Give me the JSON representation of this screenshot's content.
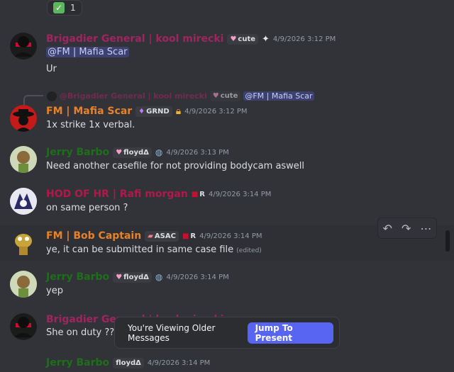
{
  "colors": {
    "brigadier": "#a0255f",
    "mafia": "#e8822a",
    "jerry": "#1e6e1a",
    "hr": "#b0194a",
    "bob": "#e8822a",
    "mention_bg": "#3c4270",
    "jump_btn": "#5865f2"
  },
  "top_reaction": {
    "icon": "check-mark-icon",
    "count": "1"
  },
  "messages": [
    {
      "username": "Brigadier General | kool mirecki",
      "badge": "cute",
      "badge_icon": "pink-heart-icon",
      "extra_icon": "sparkle-icon",
      "timestamp": "4/9/2026 3:12 PM",
      "lines": [
        "@FM | Mafia Scar",
        "Ur"
      ]
    },
    {
      "reply": {
        "username": "@Brigadier General | kool mirecki",
        "badge": "cute",
        "mention": "@FM | Mafia Scar"
      },
      "username": "FM | Mafia Scar",
      "badge": "GRND",
      "badge_icon": "purple-flame-icon",
      "extra_icon": "lock-icon",
      "timestamp": "4/9/2026 3:12 PM",
      "text": "1x strike 1x verbal."
    },
    {
      "username": "Jerry Barbo",
      "badge": "floydΔ",
      "badge_icon": "pink-heart-icon",
      "extra_icon": "globe-icon",
      "timestamp": "4/9/2026 3:13 PM",
      "text": "Need another casefile for not providing bodycam aswell"
    },
    {
      "username": "HOD OF HR | Rafi morgan",
      "badge": "R",
      "badge_icon": "hr-tag-icon",
      "timestamp": "4/9/2026 3:14 PM",
      "text": "on same person ?"
    },
    {
      "username": "FM | Bob Captain",
      "badge": "ASAC",
      "badge_icon": "bandage-icon",
      "badge2": "R",
      "timestamp": "4/9/2026 3:14 PM",
      "text": "ye, it can be submitted in same case file",
      "edited": "(edited)"
    },
    {
      "username": "Jerry Barbo",
      "badge": "floydΔ",
      "badge_icon": "pink-heart-icon",
      "extra_icon": "globe-icon",
      "timestamp": "4/9/2026 3:14 PM",
      "text": "yep"
    },
    {
      "username": "Brigadier General | kool mirecki",
      "text": "She on duty ??"
    },
    {
      "username": "Jerry Barbo",
      "badge": "floydΔ",
      "timestamp": "4/9/2026 3:14 PM"
    }
  ],
  "toolbar": {
    "reply_icon": "reply-icon",
    "forward_icon": "forward-icon",
    "more_icon": "more-icon"
  },
  "older_bar": {
    "text": "You're Viewing Older Messages",
    "button": "Jump To Present"
  }
}
